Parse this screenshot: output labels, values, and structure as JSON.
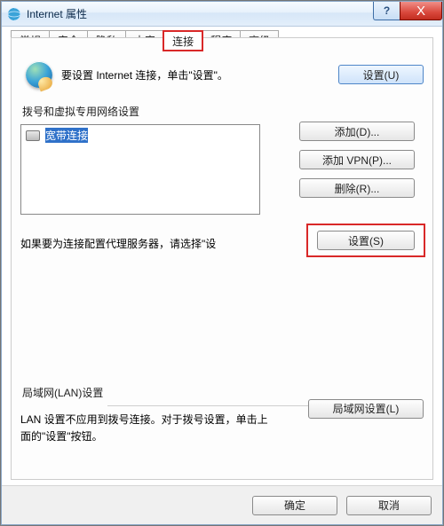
{
  "window": {
    "title": "Internet 属性"
  },
  "titlebar_buttons": {
    "help": "?",
    "close": "X"
  },
  "tabs": [
    "常规",
    "安全",
    "隐私",
    "内容",
    "连接",
    "程序",
    "高级"
  ],
  "active_tab_index": 4,
  "intro": {
    "text": "要设置 Internet 连接，单击\"设置\"。",
    "setup_button": "设置(U)"
  },
  "dial_group": {
    "label": "拨号和虚拟专用网络设置",
    "connections": [
      {
        "icon": "modem-icon",
        "name": "宽带连接",
        "selected": true
      }
    ],
    "buttons": {
      "add": "添加(D)...",
      "add_vpn": "添加 VPN(P)...",
      "remove": "删除(R)..."
    }
  },
  "proxy": {
    "text": "如果要为连接配置代理服务器，请选择\"设",
    "button": "设置(S)"
  },
  "lan": {
    "label": "局域网(LAN)设置",
    "text": "LAN 设置不应用到拨号连接。对于拨号设置，单击上面的\"设置\"按钮。",
    "button": "局域网设置(L)"
  },
  "footer": {
    "ok": "确定",
    "cancel": "取消"
  }
}
